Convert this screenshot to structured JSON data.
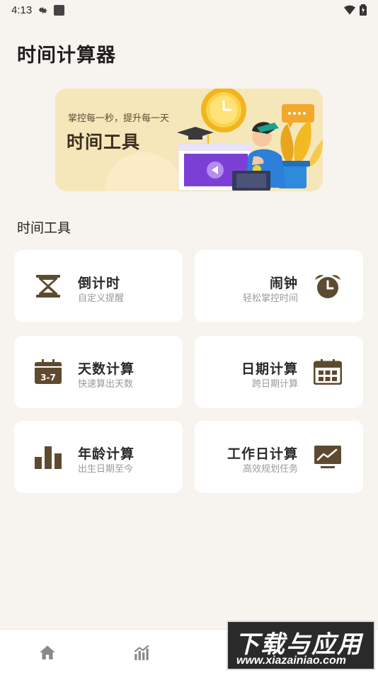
{
  "status_bar": {
    "time": "4:13"
  },
  "page": {
    "title": "时间计算器"
  },
  "banner": {
    "subtitle": "掌控每一秒，提升每一天",
    "title": "时间工具"
  },
  "section": {
    "title": "时间工具"
  },
  "tools": [
    {
      "label": "倒计时",
      "desc": "自定义提醒",
      "icon": "hourglass-icon"
    },
    {
      "label": "闹钟",
      "desc": "轻松掌控时间",
      "icon": "alarm-clock-icon"
    },
    {
      "label": "天数计算",
      "desc": "快速算出天数",
      "icon": "calendar-icon",
      "icon_text": "3-7"
    },
    {
      "label": "日期计算",
      "desc": "跨日期计算",
      "icon": "calendar-grid-icon"
    },
    {
      "label": "年龄计算",
      "desc": "出生日期至今",
      "icon": "bar-chart-icon"
    },
    {
      "label": "工作日计算",
      "desc": "高效规划任务",
      "icon": "monitor-chart-icon"
    }
  ],
  "bottom_nav": {
    "items": [
      "home-icon",
      "stats-icon",
      "grid-icon"
    ]
  },
  "watermark": {
    "title": "下载与应用",
    "url": "www.xiazainiao.com"
  },
  "colors": {
    "background": "#f7f3ef",
    "card": "#ffffff",
    "icon_brown": "#5e4a30",
    "banner": "#f6e7bb"
  }
}
